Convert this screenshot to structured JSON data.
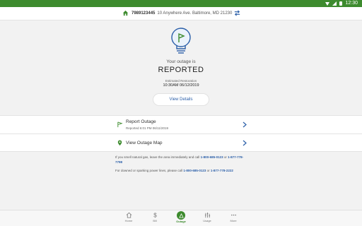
{
  "status_bar": {
    "time": "12:30"
  },
  "header": {
    "account_number": "7989123445",
    "address": "10 Anywhere Ave. Baltimore, MD 21230"
  },
  "outage": {
    "label": "Your outage is",
    "status": "REPORTED",
    "estimated_label": "Estimated Restoration",
    "estimated_value": "10:30AM 06/12/2019",
    "view_details_label": "View Details"
  },
  "rows": {
    "report": {
      "title": "Report Outage",
      "subtitle": "Reported 6:01 PM 06/11/2019"
    },
    "map": {
      "title": "View Outage Map"
    }
  },
  "info": {
    "gas_text": "If you smell natural gas, leave the area immediately and call",
    "gas_phone_1": "1-800-685-0123",
    "gas_or": "or",
    "gas_phone_2": "1-877-778-7798",
    "lines_text": "For downed or sparking power lines, please call",
    "lines_phone_1": "1-800-685-0123",
    "lines_or": "or",
    "lines_phone_2": "1-877-778-2222"
  },
  "nav": [
    {
      "label": "Home",
      "icon": "home-icon"
    },
    {
      "label": "Bill",
      "icon": "dollar-icon"
    },
    {
      "label": "Outage",
      "icon": "outage-icon"
    },
    {
      "label": "Usage",
      "icon": "usage-icon"
    },
    {
      "label": "More",
      "icon": "more-icon"
    }
  ],
  "colors": {
    "brand_green": "#3d8b2e",
    "link_blue": "#2a5ea8"
  }
}
